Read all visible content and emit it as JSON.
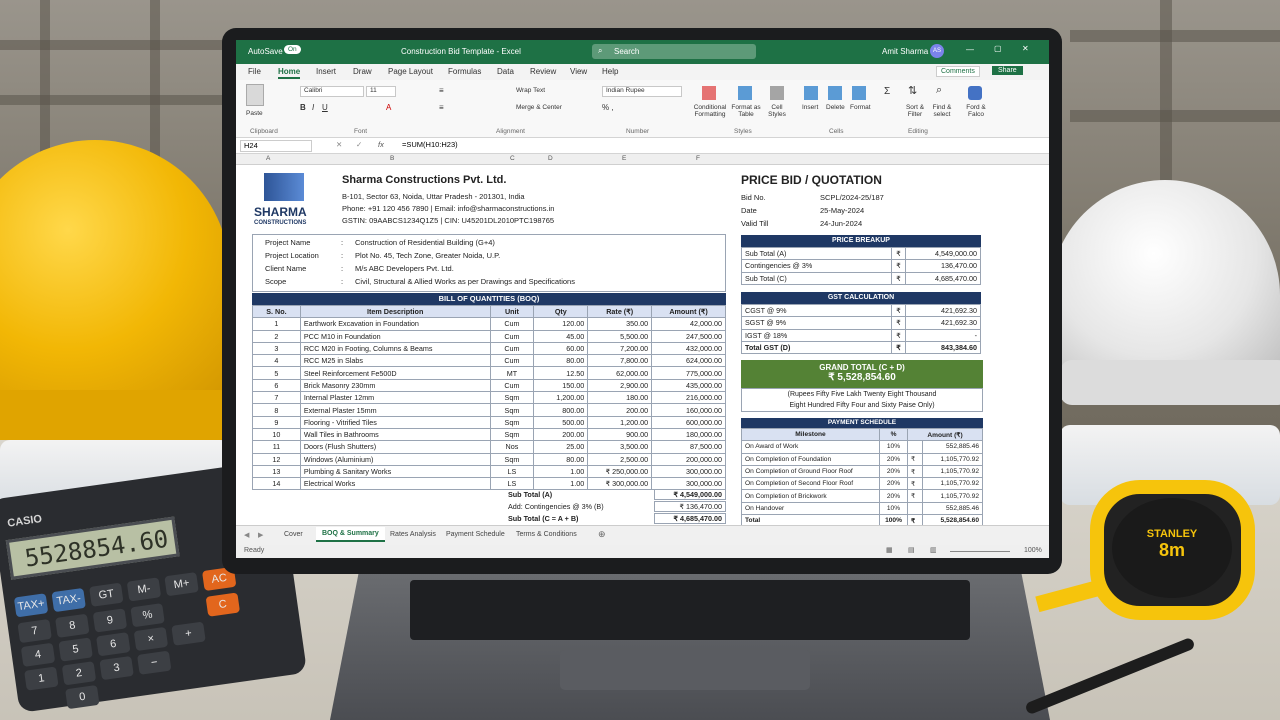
{
  "window": {
    "autosave_label": "AutoSave",
    "autosave_state": "On",
    "doc_title": "Construction Bid Template - Excel",
    "search_placeholder": "Search",
    "user_name": "Amit Sharma",
    "user_initials": "AS",
    "comments_label": "Comments",
    "share_label": "Share"
  },
  "ribbon_tabs": [
    "File",
    "Home",
    "Insert",
    "Draw",
    "Page Layout",
    "Formulas",
    "Data",
    "Review",
    "View",
    "Help"
  ],
  "ribbon": {
    "paste": "Paste",
    "font_name": "Calibri",
    "font_size": "11",
    "wrap_text": "Wrap Text",
    "merge_center": "Merge & Center",
    "number_format": "Indian Rupee",
    "conditional_formatting": "Conditional Formatting",
    "format_as_table": "Format as Table",
    "cell_styles": "Cell Styles",
    "insert": "Insert",
    "delete": "Delete",
    "format": "Format",
    "sort_filter": "Sort & Filter",
    "find_select": "Find & select",
    "ideas": "Ford & Falco",
    "groups": [
      "Clipboard",
      "Font",
      "Alignment",
      "Number",
      "Styles",
      "Cells",
      "Editing"
    ]
  },
  "formula_bar": {
    "name_box": "H24",
    "formula": "=SUM(H10:H23)"
  },
  "columns": [
    "A",
    "B",
    "C",
    "D",
    "E",
    "F"
  ],
  "company": {
    "logo_word": "SHARMA",
    "logo_sub": "CONSTRUCTIONS",
    "name": "Sharma Constructions Pvt. Ltd.",
    "address": "B-101, Sector 63, Noida, Uttar Pradesh - 201301, India",
    "contact": "Phone: +91 120 456 7890 | Email: info@sharmaconstructions.in",
    "gstin": "GSTIN: 09AABCS1234Q1Z5 | CIN: U45201DL2010PTC198765"
  },
  "quote": {
    "heading": "PRICE BID / QUOTATION",
    "bid_no_label": "Bid No.",
    "bid_no": "SCPL/2024-25/187",
    "date_label": "Date",
    "date": "25-May-2024",
    "valid_label": "Valid Till",
    "valid": "24-Jun-2024"
  },
  "project": {
    "name_label": "Project Name",
    "name": "Construction of Residential Building (G+4)",
    "location_label": "Project Location",
    "location": "Plot No. 45, Tech Zone, Greater Noida, U.P.",
    "client_label": "Client Name",
    "client": "M/s ABC Developers Pvt. Ltd.",
    "scope_label": "Scope",
    "scope": "Civil, Structural & Allied Works as per Drawings and Specifications"
  },
  "boq": {
    "title": "BILL OF QUANTITIES (BOQ)",
    "headers": [
      "S. No.",
      "Item Description",
      "Unit",
      "Qty",
      "Rate (₹)",
      "Amount (₹)"
    ],
    "rows": [
      [
        "1",
        "Earthwork Excavation in Foundation",
        "Cum",
        "120.00",
        "350.00",
        "42,000.00"
      ],
      [
        "2",
        "PCC M10 in Foundation",
        "Cum",
        "45.00",
        "5,500.00",
        "247,500.00"
      ],
      [
        "3",
        "RCC M20 in Footing, Columns & Beams",
        "Cum",
        "60.00",
        "7,200.00",
        "432,000.00"
      ],
      [
        "4",
        "RCC M25 in Slabs",
        "Cum",
        "80.00",
        "7,800.00",
        "624,000.00"
      ],
      [
        "5",
        "Steel Reinforcement Fe500D",
        "MT",
        "12.50",
        "62,000.00",
        "775,000.00"
      ],
      [
        "6",
        "Brick Masonry 230mm",
        "Cum",
        "150.00",
        "2,900.00",
        "435,000.00"
      ],
      [
        "7",
        "Internal Plaster 12mm",
        "Sqm",
        "1,200.00",
        "180.00",
        "216,000.00"
      ],
      [
        "8",
        "External Plaster 15mm",
        "Sqm",
        "800.00",
        "200.00",
        "160,000.00"
      ],
      [
        "9",
        "Flooring - Vitrified Tiles",
        "Sqm",
        "500.00",
        "1,200.00",
        "600,000.00"
      ],
      [
        "10",
        "Wall Tiles in Bathrooms",
        "Sqm",
        "200.00",
        "900.00",
        "180,000.00"
      ],
      [
        "11",
        "Doors (Flush Shutters)",
        "Nos",
        "25.00",
        "3,500.00",
        "87,500.00"
      ],
      [
        "12",
        "Windows (Aluminium)",
        "Sqm",
        "80.00",
        "2,500.00",
        "200,000.00"
      ],
      [
        "13",
        "Plumbing & Sanitary Works",
        "LS",
        "1.00",
        "₹ 250,000.00",
        "300,000.00"
      ],
      [
        "14",
        "Electrical Works",
        "LS",
        "1.00",
        "₹ 300,000.00",
        "300,000.00"
      ]
    ],
    "subtotal_label": "Sub Total (A)",
    "subtotal": "₹ 4,549,000.00",
    "contingency_label": "Add: Contingencies @ 3% (B)",
    "contingency": "₹ 136,470.00",
    "subtotal_c_label": "Sub Total (C = A + B)",
    "subtotal_c": "₹ 4,685,470.00"
  },
  "price_breakup": {
    "title": "PRICE BREAKUP",
    "rows": [
      [
        "Sub Total (A)",
        "₹",
        "4,549,000.00"
      ],
      [
        "Contingencies @ 3%",
        "₹",
        "136,470.00"
      ],
      [
        "Sub Total (C)",
        "₹",
        "4,685,470.00"
      ]
    ]
  },
  "gst": {
    "title": "GST CALCULATION",
    "rows": [
      [
        "CGST @ 9%",
        "₹",
        "421,692.30"
      ],
      [
        "SGST @ 9%",
        "₹",
        "421,692.30"
      ],
      [
        "IGST @ 18%",
        "₹",
        "-"
      ],
      [
        "Total GST (D)",
        "₹",
        "843,384.60"
      ]
    ]
  },
  "grand_total": {
    "label": "GRAND TOTAL (C + D)",
    "value": "₹ 5,528,854.60",
    "words_1": "(Rupees Fifty Five Lakh Twenty Eight Thousand",
    "words_2": "Eight Hundred Fifty Four and Sixty Paise Only)"
  },
  "payment": {
    "title": "PAYMENT SCHEDULE",
    "headers": [
      "Milestone",
      "%",
      "Amount (₹)"
    ],
    "rows": [
      [
        "On Award of Work",
        "10%",
        "",
        "552,885.46"
      ],
      [
        "On Completion of Foundation",
        "20%",
        "₹",
        "1,105,770.92"
      ],
      [
        "On Completion of Ground Floor Roof",
        "20%",
        "₹",
        "1,105,770.92"
      ],
      [
        "On Completion of Second Floor Roof",
        "20%",
        "₹",
        "1,105,770.92"
      ],
      [
        "On Completion of Brickwork",
        "20%",
        "₹",
        "1,105,770.92"
      ],
      [
        "On Handover",
        "10%",
        "",
        "552,885.46"
      ]
    ],
    "total": [
      "Total",
      "100%",
      "₹",
      "5,528,854.60"
    ]
  },
  "sheet_tabs": [
    "Cover",
    "BOQ & Summary",
    "Rates Analysis",
    "Payment Schedule",
    "Terms & Conditions"
  ],
  "status": {
    "ready": "Ready",
    "zoom": "100%"
  },
  "calculator": {
    "brand": "CASIO",
    "display": "5528854.60",
    "keys": [
      "TAX+",
      "TAX-",
      "GT",
      "M-",
      "M+",
      "7",
      "8",
      "9",
      "%",
      "4",
      "5",
      "6",
      "×",
      "1",
      "2",
      "3",
      "−",
      "0",
      "+",
      "AC",
      "C"
    ]
  },
  "tape": {
    "brand": "STANLEY",
    "length": "8m"
  }
}
